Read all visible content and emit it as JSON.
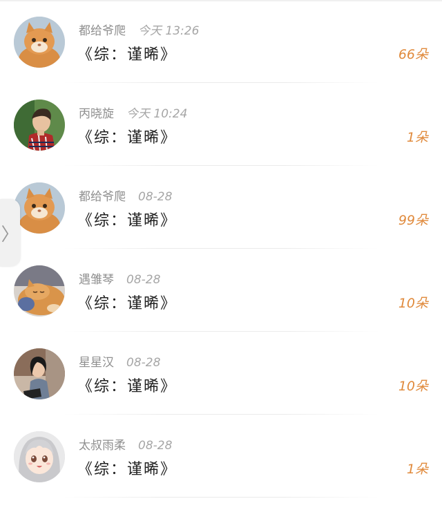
{
  "items": [
    {
      "user": "都给爷爬",
      "time": "今天 13:26",
      "title": "《综：谨晞》",
      "count": "66朵",
      "avatar": "cat-avatar"
    },
    {
      "user": "丙晓旋",
      "time": "今天 10:24",
      "title": "《综：谨晞》",
      "count": "1朵",
      "avatar": "boy-avatar"
    },
    {
      "user": "都给爷爬",
      "time": "08-28",
      "title": "《综：谨晞》",
      "count": "99朵",
      "avatar": "cat-avatar"
    },
    {
      "user": "遇雏琴",
      "time": "08-28",
      "title": "《综：谨晞》",
      "count": "10朵",
      "avatar": "sleeping-cat-avatar"
    },
    {
      "user": "星星汉",
      "time": "08-28",
      "title": "《综：谨晞》",
      "count": "10朵",
      "avatar": "girl-avatar"
    },
    {
      "user": "太叔雨柔",
      "time": "08-28",
      "title": "《综：谨晞》",
      "count": "1朵",
      "avatar": "anime-girl-avatar"
    }
  ],
  "side_handle": {
    "glyph": "〉",
    "icon": "chevron-right-icon"
  },
  "colors": {
    "accent": "#e08a3c",
    "meta": "#8f8f8f",
    "title": "#222222"
  }
}
